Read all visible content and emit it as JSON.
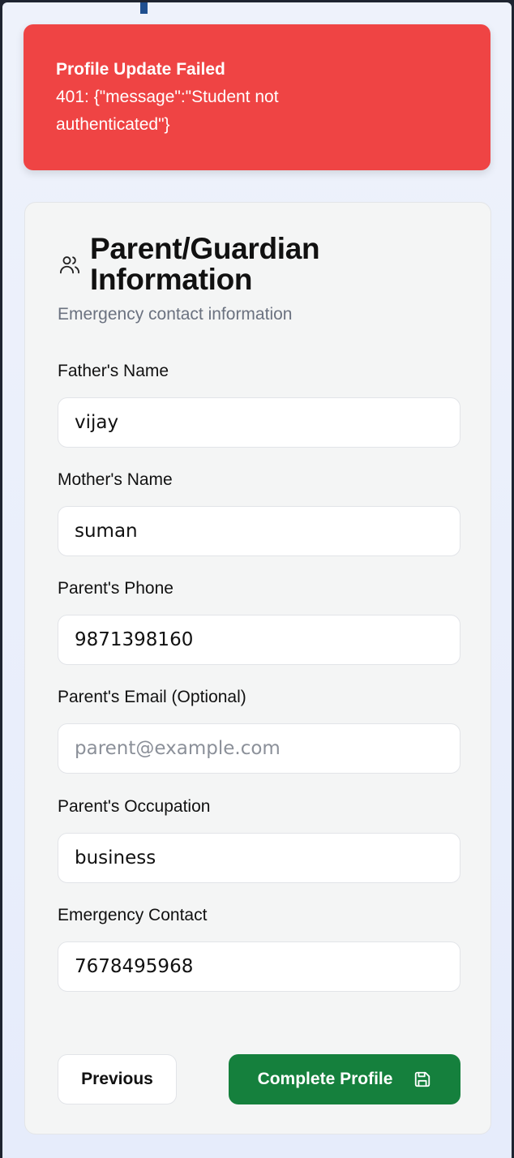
{
  "toast": {
    "title": "Profile Update Failed",
    "message": "401: {\"message\":\"Student not authenticated\"}",
    "color": "#ef4444"
  },
  "card": {
    "icon": "users-icon",
    "title": "Parent/Guardian Information",
    "subtitle": "Emergency contact information"
  },
  "fields": {
    "father_name": {
      "label": "Father's Name",
      "value": "vijay",
      "placeholder": ""
    },
    "mother_name": {
      "label": "Mother's Name",
      "value": "suman",
      "placeholder": ""
    },
    "parent_phone": {
      "label": "Parent's Phone",
      "value": "9871398160",
      "placeholder": ""
    },
    "parent_email": {
      "label": "Parent's Email (Optional)",
      "value": "",
      "placeholder": "parent@example.com"
    },
    "parent_occupation": {
      "label": "Parent's Occupation",
      "value": "business",
      "placeholder": ""
    },
    "emergency_contact": {
      "label": "Emergency Contact",
      "value": "7678495968",
      "placeholder": ""
    }
  },
  "actions": {
    "previous_label": "Previous",
    "complete_label": "Complete Profile",
    "complete_icon": "save-icon",
    "primary_color": "#15803d"
  }
}
